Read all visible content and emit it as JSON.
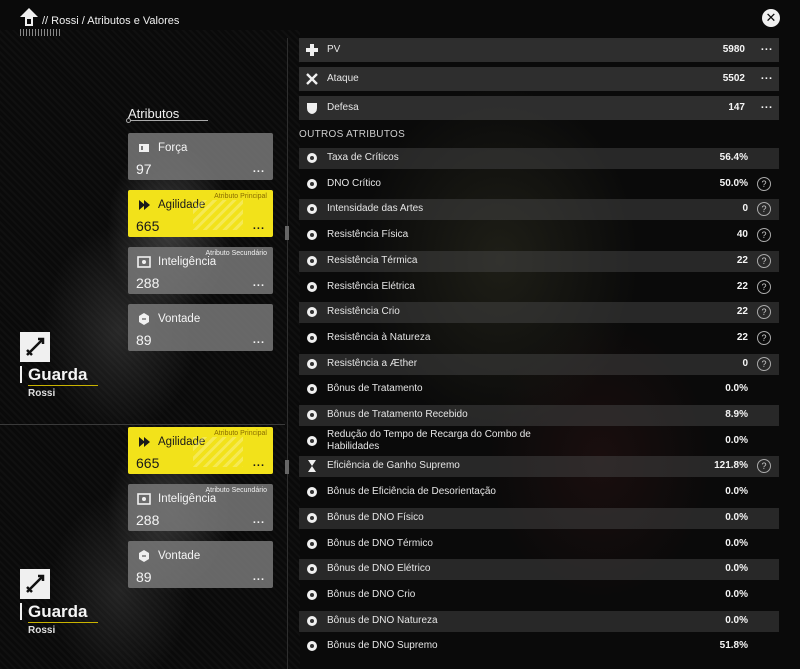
{
  "header": {
    "breadcrumb": "// Rossi / Atributos e Valores"
  },
  "left_panel": {
    "section_title": "Atributos",
    "cards_top": [
      {
        "name": "Força",
        "value": "97",
        "tag": "",
        "highlight": false,
        "icon": "strength-icon"
      },
      {
        "name": "Agilidade",
        "value": "665",
        "tag": "Atributo Principal",
        "highlight": true,
        "icon": "agility-icon"
      },
      {
        "name": "Inteligência",
        "value": "288",
        "tag": "Atributo Secundário",
        "highlight": false,
        "icon": "intellect-icon"
      },
      {
        "name": "Vontade",
        "value": "89",
        "tag": "",
        "highlight": false,
        "icon": "will-icon"
      }
    ],
    "cards_bottom": [
      {
        "name": "Agilidade",
        "value": "665",
        "tag": "Atributo Principal",
        "highlight": true,
        "icon": "agility-icon"
      },
      {
        "name": "Inteligência",
        "value": "288",
        "tag": "Atributo Secundário",
        "highlight": false,
        "icon": "intellect-icon"
      },
      {
        "name": "Vontade",
        "value": "89",
        "tag": "",
        "highlight": false,
        "icon": "will-icon"
      }
    ],
    "more_label": "...",
    "class_name": "Guarda",
    "character_name": "Rossi"
  },
  "right_panel": {
    "top_stats": [
      {
        "label": "PV",
        "value": "5980",
        "icon": "health-cross-icon"
      },
      {
        "label": "Ataque",
        "value": "5502",
        "icon": "crossed-swords-icon"
      },
      {
        "label": "Defesa",
        "value": "147",
        "icon": "shield-icon"
      }
    ],
    "other_heading": "OUTROS ATRIBUTOS",
    "help_symbol": "?",
    "other_stats": [
      {
        "label": "Taxa de Críticos",
        "value": "56.4%",
        "help": false,
        "icon": "crit-burst-icon"
      },
      {
        "label": "DNO Crítico",
        "value": "50.0%",
        "help": true,
        "icon": "crit-damage-icon"
      },
      {
        "label": "Intensidade das Artes",
        "value": "0",
        "help": true,
        "icon": "arts-intensity-icon"
      },
      {
        "label": "Resistência Física",
        "value": "40",
        "help": true,
        "icon": "physical-res-icon"
      },
      {
        "label": "Resistência Térmica",
        "value": "22",
        "help": true,
        "icon": "heat-res-icon"
      },
      {
        "label": "Resistência Elétrica",
        "value": "22",
        "help": true,
        "icon": "electric-res-icon"
      },
      {
        "label": "Resistência Crio",
        "value": "22",
        "help": true,
        "icon": "cryo-res-icon"
      },
      {
        "label": "Resistência à Natureza",
        "value": "22",
        "help": true,
        "icon": "nature-res-icon"
      },
      {
        "label": "Resistência a Æther",
        "value": "0",
        "help": true,
        "icon": "aether-res-icon"
      },
      {
        "label": "Bônus de Tratamento",
        "value": "0.0%",
        "help": false,
        "icon": "heal-bonus-icon"
      },
      {
        "label": "Bônus de Tratamento Recebido",
        "value": "8.9%",
        "help": false,
        "icon": "heal-received-icon"
      },
      {
        "label": "Redução do Tempo de Recarga do Combo de Habilidades",
        "value": "0.0%",
        "help": false,
        "icon": "cooldown-icon"
      },
      {
        "label": "Eficiência de Ganho Supremo",
        "value": "121.8%",
        "help": true,
        "icon": "hourglass-icon"
      },
      {
        "label": "Bônus de Eficiência de Desorientação",
        "value": "0.0%",
        "help": false,
        "icon": "stagger-icon"
      },
      {
        "label": "Bônus de DNO Físico",
        "value": "0.0%",
        "help": false,
        "icon": "physical-dmg-icon"
      },
      {
        "label": "Bônus de DNO Térmico",
        "value": "0.0%",
        "help": false,
        "icon": "heat-dmg-icon"
      },
      {
        "label": "Bônus de DNO Elétrico",
        "value": "0.0%",
        "help": false,
        "icon": "electric-dmg-icon"
      },
      {
        "label": "Bônus de DNO Crio",
        "value": "0.0%",
        "help": false,
        "icon": "cryo-dmg-icon"
      },
      {
        "label": "Bônus de DNO Natureza",
        "value": "0.0%",
        "help": false,
        "icon": "nature-dmg-icon"
      },
      {
        "label": "Bônus de DNO Supremo",
        "value": "51.8%",
        "help": false,
        "icon": "ultimate-dmg-icon"
      }
    ]
  },
  "colors": {
    "accent_yellow": "#f2e21a",
    "card_gray": "#787878",
    "row_gray": "#464646"
  }
}
